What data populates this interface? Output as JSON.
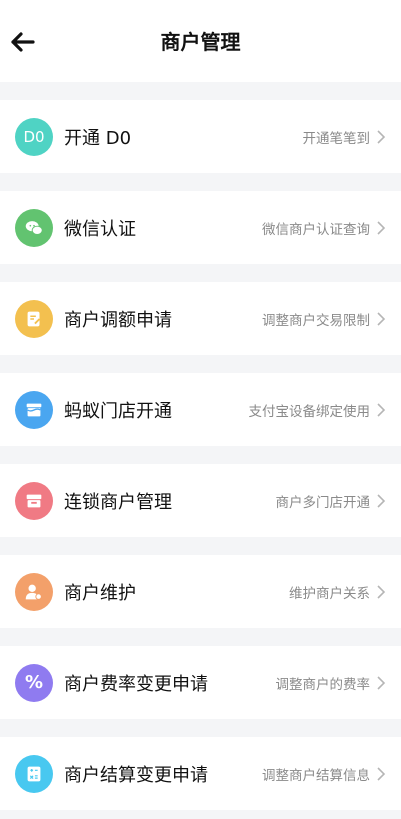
{
  "header": {
    "title": "商户管理"
  },
  "items": [
    {
      "icon": "d0-icon",
      "color": "#4fd3c4",
      "label": "开通 D0",
      "desc": "开通笔笔到",
      "icon_text": "D0"
    },
    {
      "icon": "wechat-icon",
      "color": "#62c370",
      "label": "微信认证",
      "desc": "微信商户认证查询"
    },
    {
      "icon": "edit-document-icon",
      "color": "#f3c04f",
      "label": "商户调额申请",
      "desc": "调整商户交易限制"
    },
    {
      "icon": "store-icon",
      "color": "#4aa6f0",
      "label": "蚂蚁门店开通",
      "desc": "支付宝设备绑定使用"
    },
    {
      "icon": "chain-store-icon",
      "color": "#f07a84",
      "label": "连锁商户管理",
      "desc": "商户多门店开通"
    },
    {
      "icon": "user-maintain-icon",
      "color": "#f3a06a",
      "label": "商户维护",
      "desc": "维护商户关系"
    },
    {
      "icon": "percent-icon",
      "color": "#8f7bf0",
      "label": "商户费率变更申请",
      "desc": "调整商户的费率",
      "icon_text": "%"
    },
    {
      "icon": "settlement-icon",
      "color": "#48c8f0",
      "label": "商户结算变更申请",
      "desc": "调整商户结算信息"
    }
  ]
}
